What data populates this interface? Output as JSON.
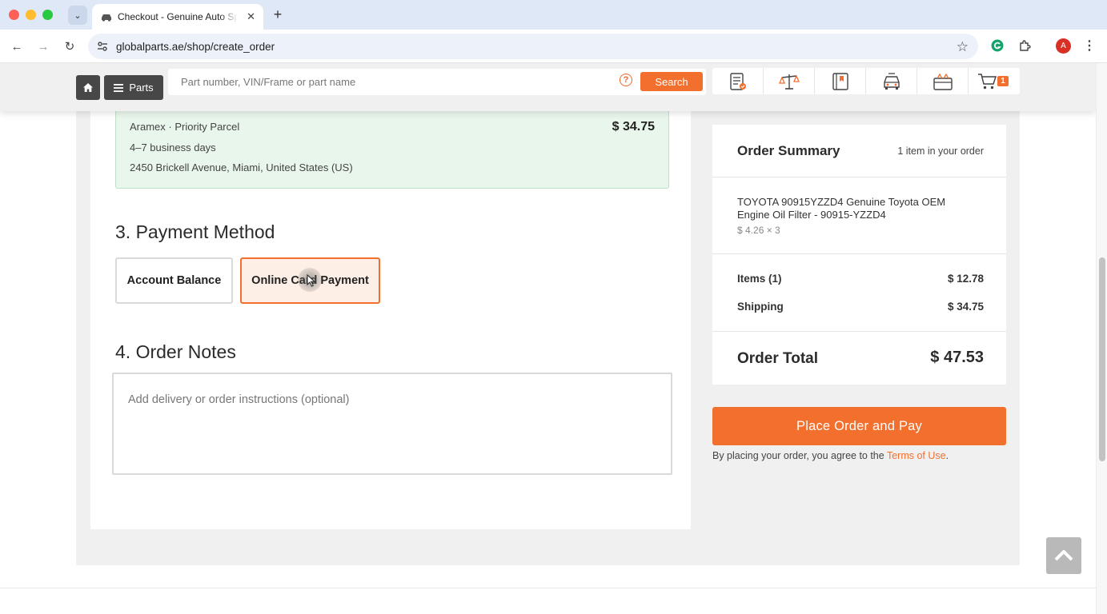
{
  "browser": {
    "tab_title": "Checkout - Genuine Auto Spa",
    "url": "globalparts.ae/shop/create_order",
    "profile_initial": "A"
  },
  "header": {
    "parts_label": "Parts",
    "search_placeholder": "Part number, VIN/Frame or part name",
    "search_button": "Search",
    "help_symbol": "?",
    "cart_count": "1",
    "icons": [
      "order-list-icon",
      "balance-scale-icon",
      "catalog-book-icon",
      "car-icon",
      "garage-icon",
      "cart-icon"
    ]
  },
  "shipping": {
    "carrier": "Aramex · Priority Parcel",
    "delivery_time": "4–7 business days",
    "address": "2450 Brickell Avenue, Miami, United States (US)",
    "price": "$ 34.75"
  },
  "payment": {
    "title": "3. Payment Method",
    "options": [
      "Account Balance",
      "Online Card Payment"
    ],
    "selected": "Online Card Payment"
  },
  "notes": {
    "title": "4. Order Notes",
    "placeholder": "Add delivery or order instructions (optional)"
  },
  "summary": {
    "title": "Order Summary",
    "count_text": "1 item in your order",
    "item_name": "TOYOTA 90915YZZD4 Genuine Toyota OEM Engine Oil Filter - 90915-YZZD4",
    "item_qty": "$ 4.26 × 3",
    "items_label": "Items (1)",
    "items_value": "$ 12.78",
    "shipping_label": "Shipping",
    "shipping_value": "$ 34.75",
    "total_label": "Order Total",
    "total_value": "$ 47.53"
  },
  "checkout": {
    "place_order_button": "Place Order and Pay",
    "agree_prefix": "By placing your order, you agree to the ",
    "terms_link": "Terms of Use",
    "agree_suffix": "."
  },
  "colors": {
    "accent": "#f26f2d",
    "shipping_box_bg": "#e9f6ec",
    "header_button_bg": "#474747"
  }
}
